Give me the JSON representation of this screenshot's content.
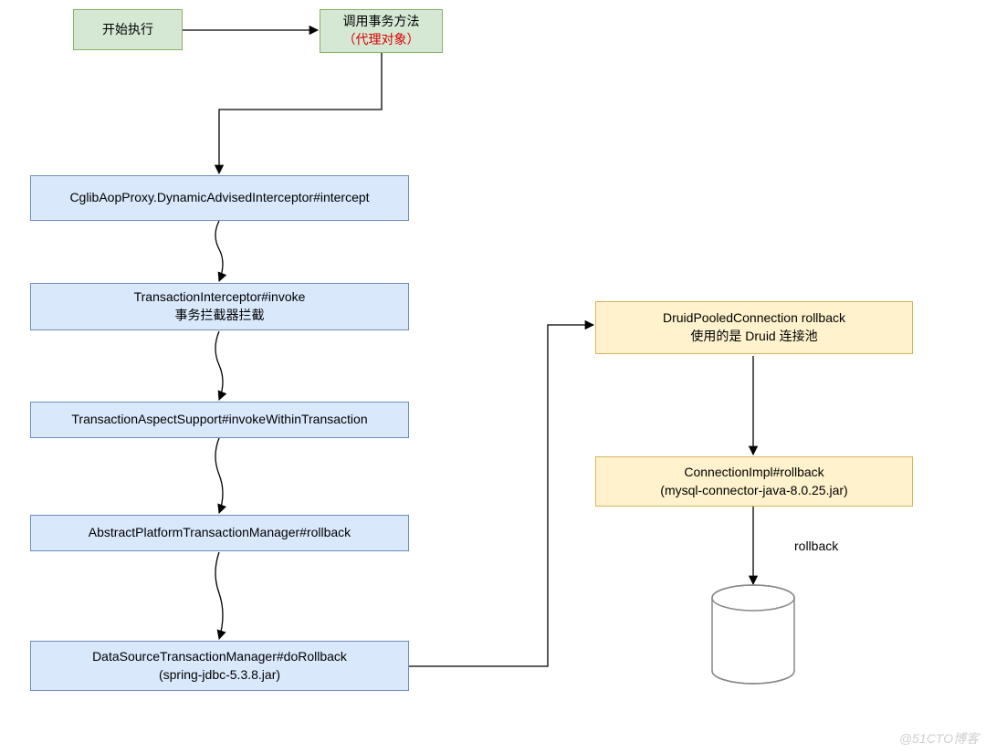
{
  "nodes": {
    "start": {
      "line1": "开始执行"
    },
    "proxy": {
      "line1": "调用事务方法",
      "line2": "（代理对象）"
    },
    "intercept": {
      "line1": "CglibAopProxy.DynamicAdvisedInterceptor#intercept"
    },
    "txInterceptor": {
      "line1": "TransactionInterceptor#invoke",
      "line2": "事务拦截器拦截"
    },
    "aspect": {
      "line1": "TransactionAspectSupport#invokeWithinTransaction"
    },
    "abstractMgr": {
      "line1": "AbstractPlatformTransactionManager#rollback"
    },
    "dsMgr": {
      "line1": "DataSourceTransactionManager#doRollback",
      "line2": "(spring-jdbc-5.3.8.jar)"
    },
    "druid": {
      "line1": "DruidPooledConnection rollback",
      "line2": "使用的是 Druid 连接池"
    },
    "mysql": {
      "line1": "ConnectionImpl#rollback",
      "line2": "(mysql-connector-java-8.0.25.jar)"
    }
  },
  "labels": {
    "rollback": "rollback"
  },
  "watermark": "@51CTO博客"
}
